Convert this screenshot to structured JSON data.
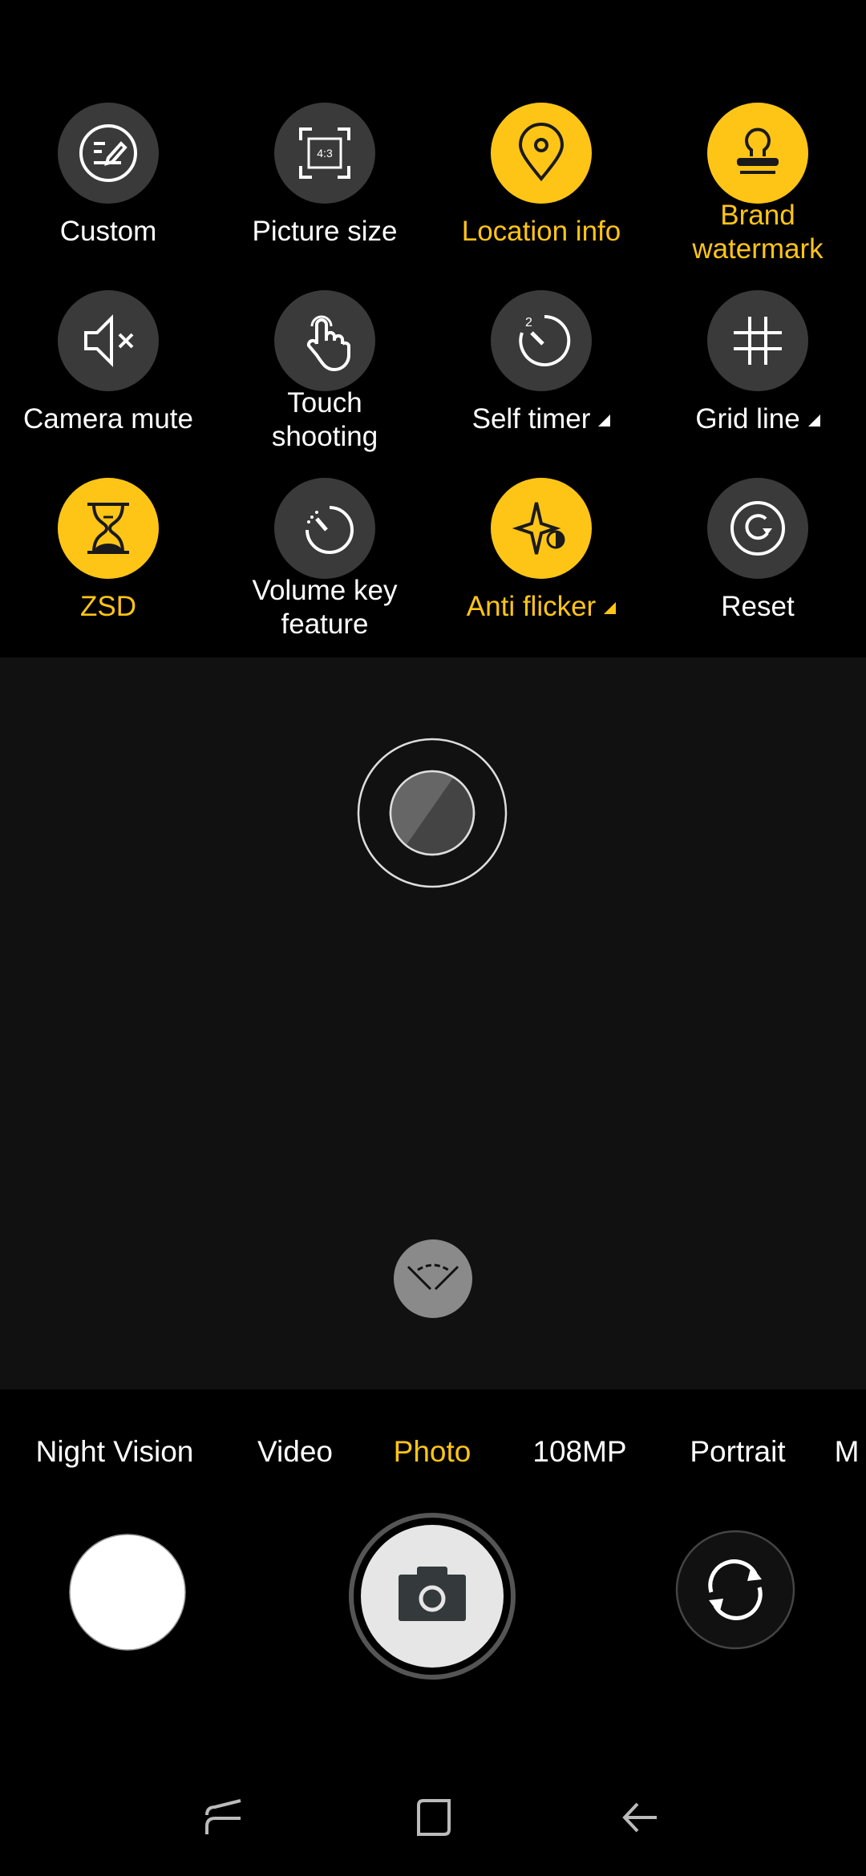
{
  "colors": {
    "accent": "#ffc516",
    "tile_bg": "#3a3a3a",
    "preview_bg": "#111111"
  },
  "settings": [
    {
      "label": "Custom",
      "icon": "edit-icon",
      "active": false
    },
    {
      "label": "Picture size",
      "icon": "aspect-ratio-icon",
      "icon_text": "4:3",
      "active": false
    },
    {
      "label": "Location info",
      "icon": "location-pin-icon",
      "active": true
    },
    {
      "label": "Brand watermark",
      "icon": "stamp-icon",
      "active": true
    },
    {
      "label": "Camera mute",
      "icon": "speaker-mute-icon",
      "active": false
    },
    {
      "label": "Touch shooting",
      "icon": "touch-hand-icon",
      "active": false
    },
    {
      "label": "Self timer",
      "icon": "timer-icon",
      "icon_text": "2",
      "active": false,
      "dropdown": true
    },
    {
      "label": "Grid line",
      "icon": "grid-icon",
      "active": false,
      "dropdown": true
    },
    {
      "label": "ZSD",
      "icon": "hourglass-icon",
      "active": true
    },
    {
      "label": "Volume key feature",
      "icon": "dial-icon",
      "active": false
    },
    {
      "label": "Anti flicker",
      "icon": "sparkle-icon",
      "active": true,
      "dropdown": true
    },
    {
      "label": "Reset",
      "icon": "reset-icon",
      "active": false
    }
  ],
  "modes": [
    {
      "label": "Night Vision",
      "active": false
    },
    {
      "label": "Video",
      "active": false
    },
    {
      "label": "Photo",
      "active": true
    },
    {
      "label": "108MP",
      "active": false
    },
    {
      "label": "Portrait",
      "active": false
    },
    {
      "label": "M",
      "active": false
    }
  ]
}
